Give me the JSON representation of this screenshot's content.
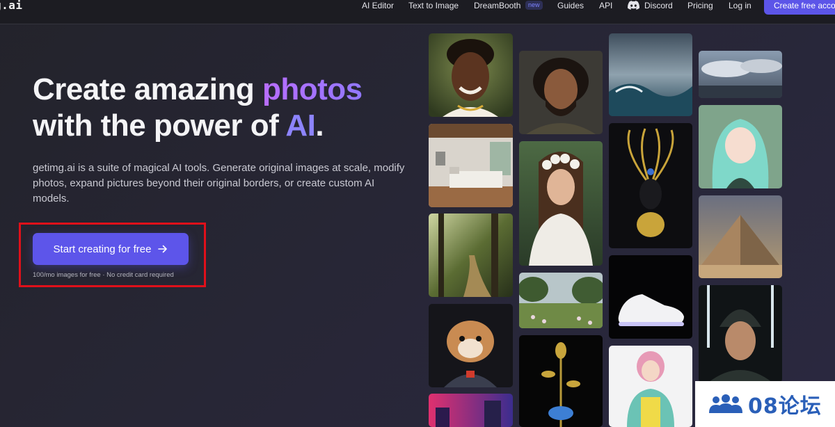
{
  "nav": {
    "logo": "g.ai",
    "links": [
      "AI Editor",
      "Text to Image",
      "DreamBooth",
      "Guides",
      "API",
      "Discord",
      "Pricing",
      "Log in"
    ],
    "new_badge": "new",
    "cta": "Create free account"
  },
  "hero": {
    "title_1": "Create amazing ",
    "title_accent_1": "photos",
    "title_2": "with the power of ",
    "title_accent_2": "AI",
    "title_end": ".",
    "description": "getimg.ai is a suite of magical AI tools. Generate original images at scale, modify photos, expand pictures beyond their original borders, or create custom AI models.",
    "button_label": "Start creating for free",
    "note": "100/mo images for free · No credit card required"
  },
  "gallery": {
    "tiles": [
      "portrait-smiling-man",
      "bedroom-interior",
      "forest-path",
      "hamster-astronaut",
      "neon-city",
      "bearded-warrior",
      "flower-crown-woman",
      "garden-landscape",
      "golden-flower-sculpture",
      "stormy-sea",
      "golden-mask-idol",
      "white-sneaker",
      "pink-hair-figure",
      "cloudy-horizon",
      "anime-girl",
      "pyramid",
      "cyber-samurai"
    ]
  },
  "watermark": {
    "text": "08论坛"
  },
  "colors": {
    "accent": "#5d55ea",
    "highlight_box": "#e0101a",
    "background": "#26253a"
  }
}
